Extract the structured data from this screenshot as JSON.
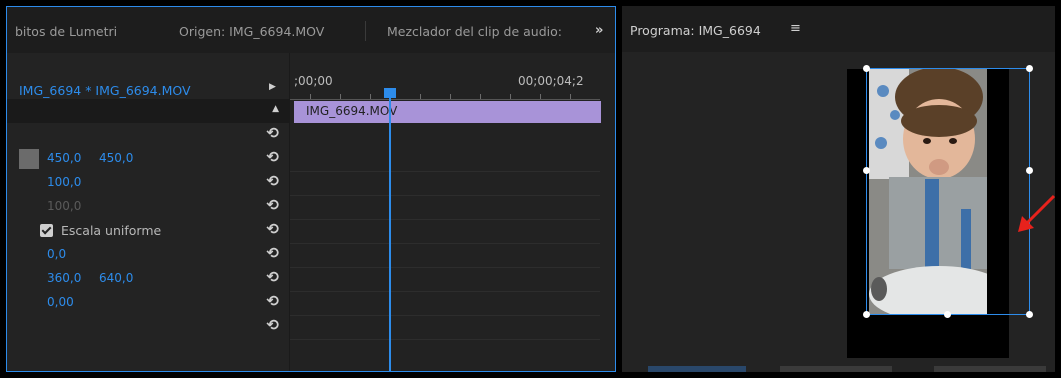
{
  "effect_controls_panel": {
    "tabs": [
      "bitos de Lumetri",
      "Origen: IMG_6694.MOV",
      "Mezclador del clip de audio:"
    ],
    "overflow_label": "»",
    "clip_title": "IMG_6694 * IMG_6694.MOV",
    "rows": [
      {
        "values": []
      },
      {
        "values": [
          "450,0",
          "450,0"
        ]
      },
      {
        "values": [
          "100,0"
        ]
      },
      {
        "values": [
          "100,0"
        ],
        "dim": true
      },
      {
        "checkbox_label": "Escala uniforme"
      },
      {
        "values": [
          "0,0"
        ]
      },
      {
        "values": [
          "360,0",
          "640,0"
        ]
      },
      {
        "values": [
          "0,00"
        ]
      },
      {
        "values": []
      }
    ]
  },
  "timeline": {
    "start_time": ";00;00",
    "end_time": "00;00;04;2",
    "clip_label": "IMG_6694.MOV"
  },
  "program_monitor": {
    "title": "Programa: IMG_6694",
    "menu_icon": "≡"
  },
  "colors": {
    "accent": "#2d8ceb",
    "clip": "#a893d8",
    "panel_bg": "#232323",
    "arrow": "#e8221c"
  }
}
